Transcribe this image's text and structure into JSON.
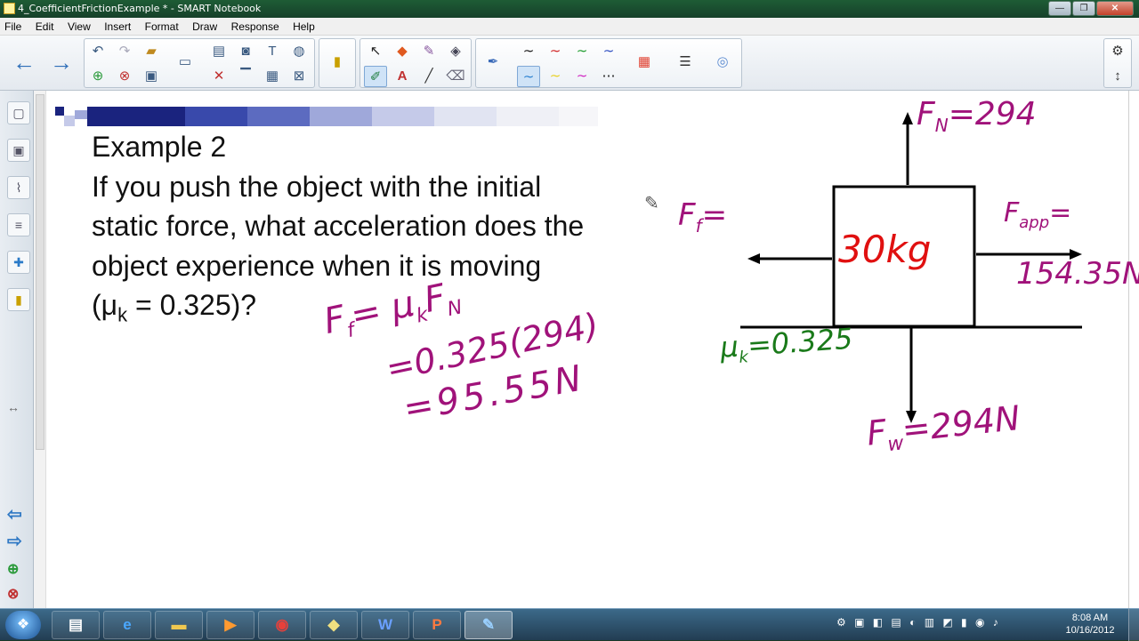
{
  "window": {
    "title": "4_CoefficientFrictionExample * - SMART Notebook",
    "minimize": "—",
    "maximize": "❐",
    "close": "✕"
  },
  "menu": [
    "File",
    "Edit",
    "View",
    "Insert",
    "Format",
    "Draw",
    "Response",
    "Help"
  ],
  "lesson": {
    "heading": "Example 2",
    "line1": "If you push the object with the initial",
    "line2": "static force, what acceleration does the",
    "line3": "object experience when it is moving",
    "mu_open": "(μ",
    "mu_sub": "k",
    "mu_close": " = 0.325)?"
  },
  "handwriting": {
    "ff_formula": "F",
    "ff_sub": "f",
    "ff_rhs": "= μ",
    "ff_rhs_sub": "k",
    "ff_rhs_f": "F",
    "ff_rhs_n": "N",
    "line2": "=0.325(294)",
    "line3": "=95.55N",
    "fn_label": "F",
    "fn_sub": "N",
    "fn_value": "=294",
    "ff_label_left": "F",
    "ff_label_left_sub": "f",
    "ff_label_left_eq": "=",
    "fapp_label": "F",
    "fapp_sub": "app",
    "fapp_eq": "=",
    "fapp_value": "154.35N",
    "mass": "30kg",
    "mu_k": "μ",
    "mu_k_sub": "k",
    "mu_k_value": "=0.325",
    "fw_label": "F",
    "fw_sub": "w",
    "fw_value": "=294N"
  },
  "taskbar": {
    "time": "8:08 AM",
    "date": "10/16/2012"
  },
  "colors": {
    "ink_purple": "#a0127a",
    "ink_red": "#e01010",
    "ink_green": "#1a7a1a"
  }
}
